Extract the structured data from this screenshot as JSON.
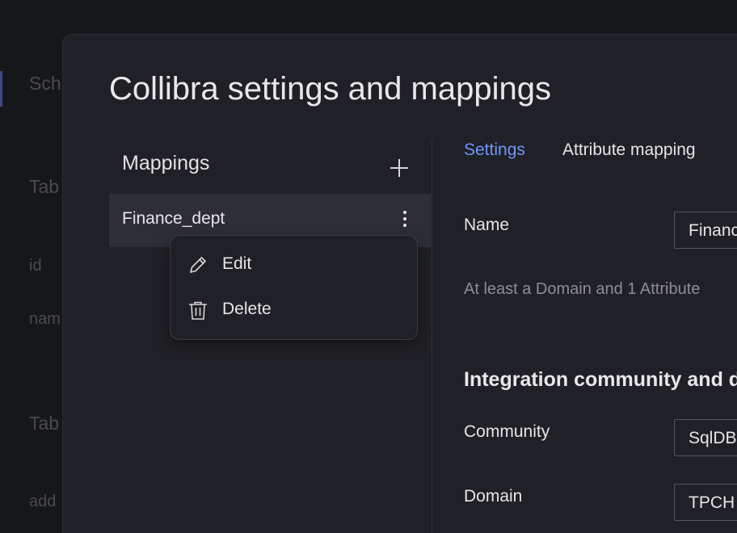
{
  "background": {
    "items": [
      "Sch",
      "Tab",
      "id",
      "nam",
      "Tab",
      "add"
    ]
  },
  "modal": {
    "title": "Collibra settings and mappings"
  },
  "mappings": {
    "header": "Mappings",
    "add_icon": "plus-icon",
    "items": [
      {
        "label": "Finance_dept",
        "menu_icon": "kebab-menu-icon"
      }
    ]
  },
  "context_menu": {
    "items": [
      {
        "label": "Edit",
        "icon": "pencil-icon"
      },
      {
        "label": "Delete",
        "icon": "trash-icon"
      }
    ]
  },
  "tabs": [
    {
      "label": "Settings",
      "active": true
    },
    {
      "label": "Attribute mapping",
      "active": false
    }
  ],
  "settings": {
    "name_label": "Name",
    "name_value": "Finance_dept",
    "hint": "At least a Domain and 1 Attribute",
    "section_heading": "Integration community and domain",
    "community_label": "Community",
    "community_value": "SqlDBM",
    "domain_label": "Domain",
    "domain_value": "TPCH"
  },
  "colors": {
    "accent": "#6f96ff",
    "modal_bg": "#202126",
    "selected_row": "#2e2f36"
  }
}
